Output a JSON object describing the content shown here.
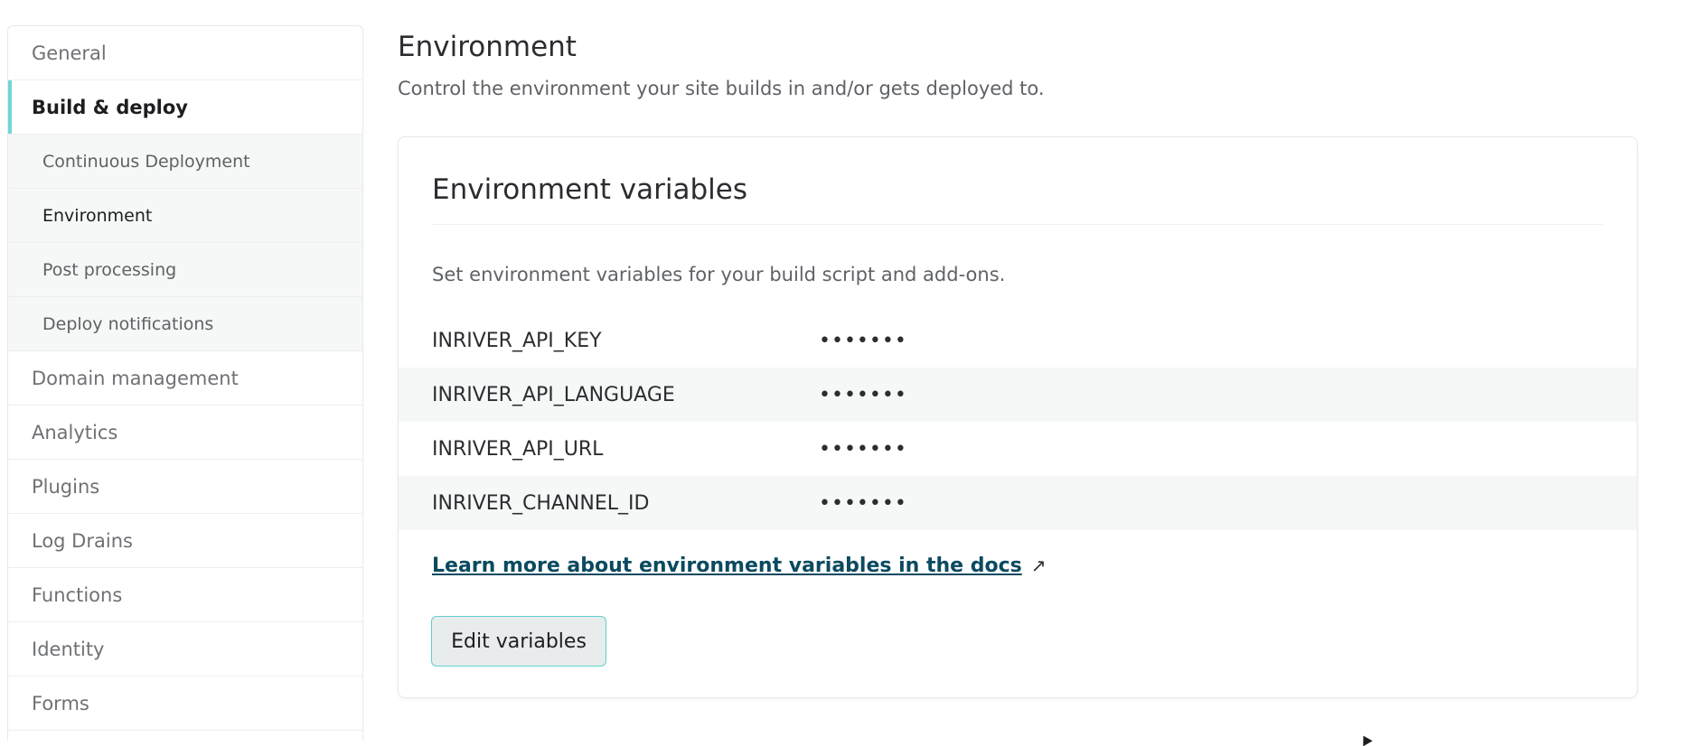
{
  "sidebar": {
    "items": [
      {
        "label": "General"
      },
      {
        "label": "Build & deploy",
        "active": true
      },
      {
        "label": "Domain management"
      },
      {
        "label": "Analytics"
      },
      {
        "label": "Plugins"
      },
      {
        "label": "Log Drains"
      },
      {
        "label": "Functions"
      },
      {
        "label": "Identity"
      },
      {
        "label": "Forms"
      }
    ],
    "sub_items": [
      {
        "label": "Continuous Deployment"
      },
      {
        "label": "Environment",
        "current": true
      },
      {
        "label": "Post processing"
      },
      {
        "label": "Deploy notifications"
      }
    ]
  },
  "main": {
    "title": "Environment",
    "description": "Control the environment your site builds in and/or gets deployed to.",
    "card": {
      "title": "Environment variables",
      "description": "Set environment variables for your build script and add-ons.",
      "variables": [
        {
          "key": "INRIVER_API_KEY",
          "value": "•••••••"
        },
        {
          "key": "INRIVER_API_LANGUAGE",
          "value": "•••••••"
        },
        {
          "key": "INRIVER_API_URL",
          "value": "•••••••"
        },
        {
          "key": "INRIVER_CHANNEL_ID",
          "value": "•••••••"
        }
      ],
      "docs_link": "Learn more about environment variables in the docs",
      "external_icon": "↗",
      "edit_button": "Edit variables"
    }
  },
  "colors": {
    "accent": "#6fd6d8",
    "link": "#0b4a5f",
    "button_border": "#5fd0cf"
  },
  "icons": {
    "docs_link": "external-link-icon",
    "pointer": "mouse-cursor-icon"
  }
}
